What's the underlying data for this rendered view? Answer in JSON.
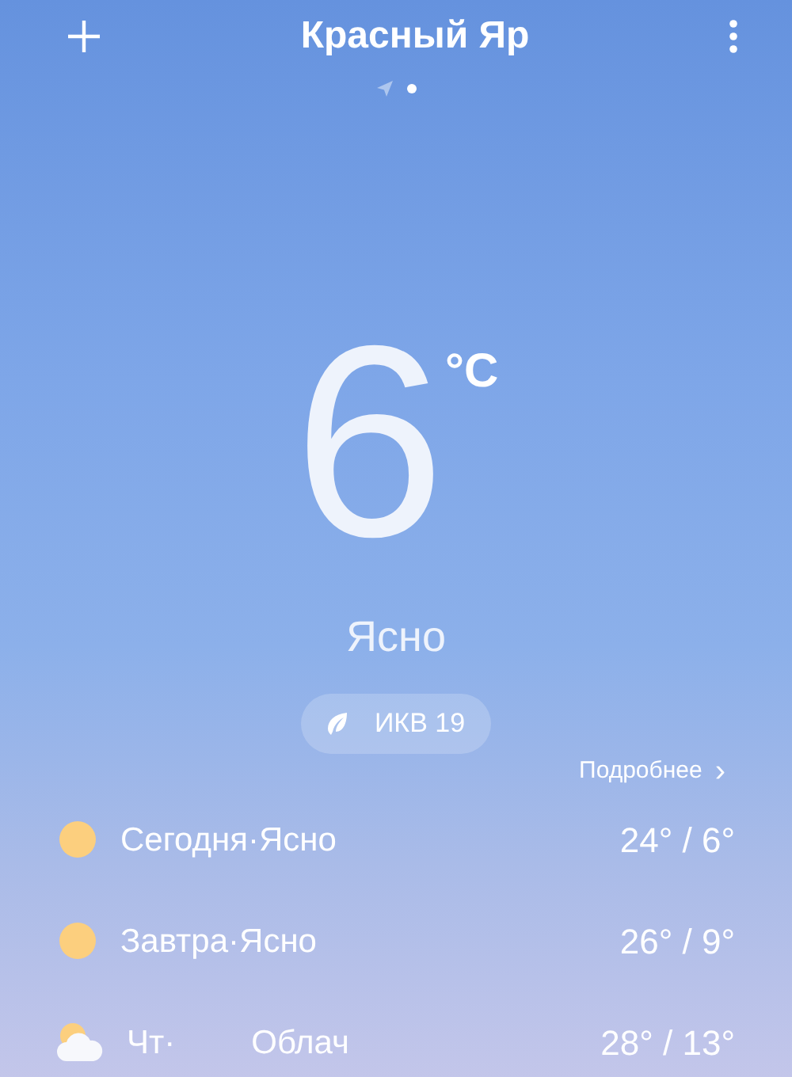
{
  "header": {
    "title": "Красный Яр",
    "pages": [
      {
        "kind": "location",
        "selected": false
      },
      {
        "kind": "dot",
        "selected": true
      }
    ]
  },
  "current": {
    "temperature": "6",
    "unit": "°C",
    "condition": "Ясно",
    "aqi": "ИКВ 19"
  },
  "details_link": "Подробнее",
  "details_chevron": "›",
  "forecast": [
    {
      "kind": "sun",
      "label_parts": [
        "Сегодня·Ясно"
      ],
      "temps": "24° / 6°"
    },
    {
      "kind": "sun",
      "label_parts": [
        "Завтра·Ясно"
      ],
      "temps": "26° / 9°"
    },
    {
      "kind": "partly-cloudy",
      "label_parts": [
        "Чт·",
        "Облач"
      ],
      "temps": "28° / 13°"
    }
  ]
}
